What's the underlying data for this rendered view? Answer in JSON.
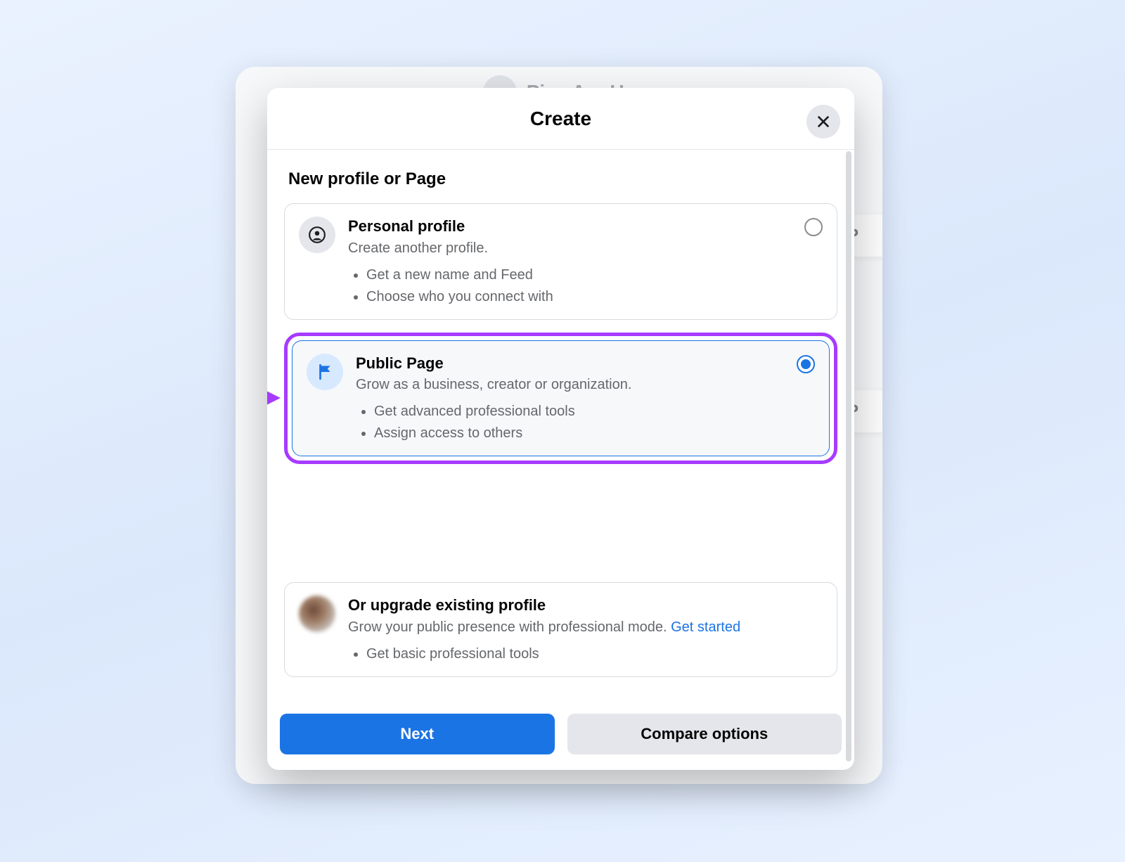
{
  "backdrop": {
    "page_name": "Pies Are Us",
    "peek1": "P",
    "peek2": "P"
  },
  "modal": {
    "title": "Create",
    "section_title": "New profile or Page",
    "options": [
      {
        "icon": "person-circle-icon",
        "title": "Personal profile",
        "subtitle": "Create another profile.",
        "bullets": [
          "Get a new name and Feed",
          "Choose who you connect with"
        ],
        "selected": false
      },
      {
        "icon": "flag-icon",
        "title": "Public Page",
        "subtitle": "Grow as a business, creator or organization.",
        "bullets": [
          "Get advanced professional tools",
          "Assign access to others"
        ],
        "selected": true
      }
    ],
    "upgrade": {
      "title": "Or upgrade existing profile",
      "subtitle_prefix": "Grow your public presence with professional mode. ",
      "link_text": "Get started",
      "bullets": [
        "Get basic professional tools"
      ]
    },
    "buttons": {
      "next": "Next",
      "compare": "Compare options"
    }
  }
}
